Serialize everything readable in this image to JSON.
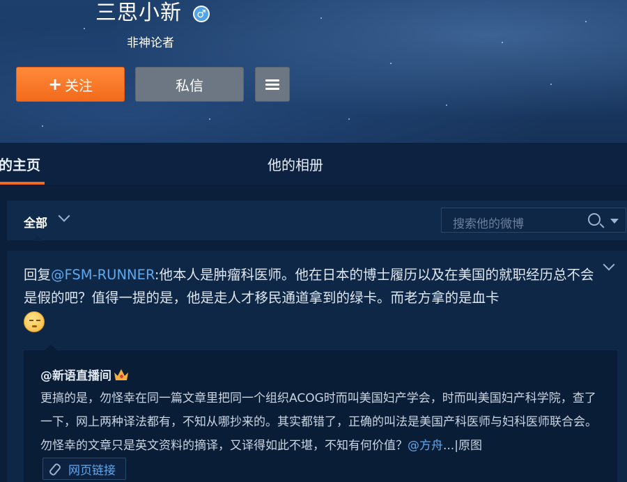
{
  "profile": {
    "name": "三思小新",
    "gender_symbol": "♂",
    "bio": "非神论者"
  },
  "actions": {
    "follow_plus": "+",
    "follow_label": "关注",
    "message_label": "私信",
    "menu_icon": "hamburger-menu-icon"
  },
  "tabs": {
    "home_label": "的主页",
    "albums_label": "他的相册"
  },
  "filter": {
    "selected": "全部",
    "search_placeholder": "搜索他的微博"
  },
  "post": {
    "reply_prefix": "回复",
    "mention": "@FSM-RUNNER",
    "text": ":他本人是肿瘤科医师。他在日本的博士履历以及在美国的就职经历总不会是假的吧？值得一提的是，他是走人才移民通道拿到的绿卡。而老方拿的是血卡",
    "emoji": "face-emoji-icon"
  },
  "repost": {
    "user": "@新语直播间",
    "text": "更搞的是，勿怪幸在同一篇文章里把同一个组织ACOG时而叫美国妇产学会，时而叫美国妇产科学院，查了一下，网上两种译法都有，不知从哪抄来的。其实都错了，正确的叫法是美国产科医师与妇科医师联合会。勿怪幸的文章只是英文资料的摘译，又译得如此不堪，不知有何价值？",
    "mention": "@方舟",
    "more": "...",
    "separator": "|",
    "original_link": "原图",
    "link_chip": "网页链接"
  },
  "colors": {
    "accent_orange": "#f26a1b",
    "link_blue": "#5fa8ee",
    "page_bg": "#0b1f3a"
  }
}
